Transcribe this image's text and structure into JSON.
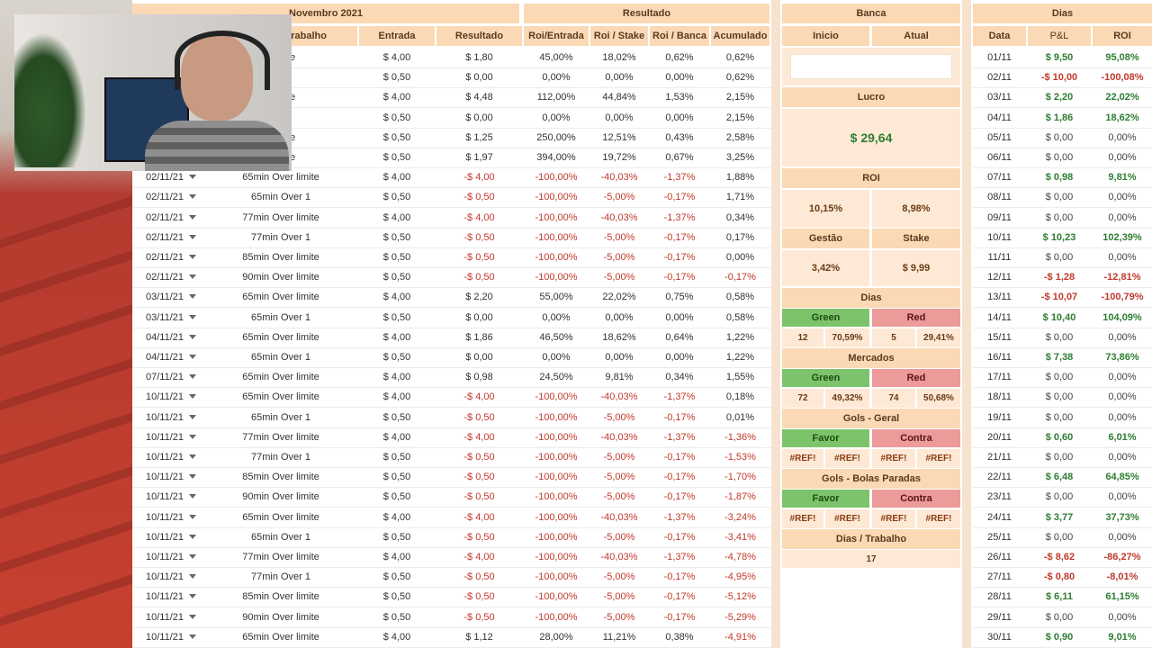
{
  "header": {
    "month": "Novembro 2021",
    "resultado": "Resultado",
    "banca": "Banca",
    "dias": "Dias"
  },
  "columns": {
    "trabalho": "rabalho",
    "entrada": "Entrada",
    "resultado": "Resultado",
    "roi_entrada": "Roi/Entrada",
    "roi_stake": "Roi / Stake",
    "roi_banca": "Roi / Banca",
    "acumulado": "Acumulado",
    "inicio": "Inicio",
    "atual": "Atual",
    "data": "Data",
    "pl": "P&L",
    "roi": "ROI"
  },
  "rows": [
    {
      "date": "",
      "market": "r limite",
      "entrada": "$ 4,00",
      "resultado": "$ 1,80",
      "roi_e": "45,00%",
      "roi_s": "18,02%",
      "roi_b": "0,62%",
      "acum": "0,62%",
      "cls": "zero"
    },
    {
      "date": "",
      "market": "ver 1",
      "entrada": "$ 0,50",
      "resultado": "$ 0,00",
      "roi_e": "0,00%",
      "roi_s": "0,00%",
      "roi_b": "0,00%",
      "acum": "0,62%",
      "cls": "zero"
    },
    {
      "date": "",
      "market": "r limite",
      "entrada": "$ 4,00",
      "resultado": "$ 4,48",
      "roi_e": "112,00%",
      "roi_s": "44,84%",
      "roi_b": "1,53%",
      "acum": "2,15%",
      "cls": "zero"
    },
    {
      "date": "",
      "market": "ver 1",
      "entrada": "$ 0,50",
      "resultado": "$ 0,00",
      "roi_e": "0,00%",
      "roi_s": "0,00%",
      "roi_b": "0,00%",
      "acum": "2,15%",
      "cls": "zero"
    },
    {
      "date": "",
      "market": "r limite",
      "entrada": "$ 0,50",
      "resultado": "$ 1,25",
      "roi_e": "250,00%",
      "roi_s": "12,51%",
      "roi_b": "0,43%",
      "acum": "2,58%",
      "cls": "zero"
    },
    {
      "date": "",
      "market": "r limite",
      "entrada": "$ 0,50",
      "resultado": "$ 1,97",
      "roi_e": "394,00%",
      "roi_s": "19,72%",
      "roi_b": "0,67%",
      "acum": "3,25%",
      "cls": "zero"
    },
    {
      "date": "02/11/21",
      "market": "65min Over limite",
      "entrada": "$ 4,00",
      "resultado": "-$ 4,00",
      "roi_e": "-100,00%",
      "roi_s": "-40,03%",
      "roi_b": "-1,37%",
      "acum": "1,88%",
      "cls": "neg"
    },
    {
      "date": "02/11/21",
      "market": "65min Over 1",
      "entrada": "$ 0,50",
      "resultado": "-$ 0,50",
      "roi_e": "-100,00%",
      "roi_s": "-5,00%",
      "roi_b": "-0,17%",
      "acum": "1,71%",
      "cls": "neg"
    },
    {
      "date": "02/11/21",
      "market": "77min Over limite",
      "entrada": "$ 4,00",
      "resultado": "-$ 4,00",
      "roi_e": "-100,00%",
      "roi_s": "-40,03%",
      "roi_b": "-1,37%",
      "acum": "0,34%",
      "cls": "neg"
    },
    {
      "date": "02/11/21",
      "market": "77min Over 1",
      "entrada": "$ 0,50",
      "resultado": "-$ 0,50",
      "roi_e": "-100,00%",
      "roi_s": "-5,00%",
      "roi_b": "-0,17%",
      "acum": "0,17%",
      "cls": "neg"
    },
    {
      "date": "02/11/21",
      "market": "85min Over limite",
      "entrada": "$ 0,50",
      "resultado": "-$ 0,50",
      "roi_e": "-100,00%",
      "roi_s": "-5,00%",
      "roi_b": "-0,17%",
      "acum": "0,00%",
      "cls": "neg"
    },
    {
      "date": "02/11/21",
      "market": "90min Over limite",
      "entrada": "$ 0,50",
      "resultado": "-$ 0,50",
      "roi_e": "-100,00%",
      "roi_s": "-5,00%",
      "roi_b": "-0,17%",
      "acum": "-0,17%",
      "cls": "neg"
    },
    {
      "date": "03/11/21",
      "market": "65min Over limite",
      "entrada": "$ 4,00",
      "resultado": "$ 2,20",
      "roi_e": "55,00%",
      "roi_s": "22,02%",
      "roi_b": "0,75%",
      "acum": "0,58%",
      "cls": "zero"
    },
    {
      "date": "03/11/21",
      "market": "65min Over 1",
      "entrada": "$ 0,50",
      "resultado": "$ 0,00",
      "roi_e": "0,00%",
      "roi_s": "0,00%",
      "roi_b": "0,00%",
      "acum": "0,58%",
      "cls": "zero"
    },
    {
      "date": "04/11/21",
      "market": "65min Over limite",
      "entrada": "$ 4,00",
      "resultado": "$ 1,86",
      "roi_e": "46,50%",
      "roi_s": "18,62%",
      "roi_b": "0,64%",
      "acum": "1,22%",
      "cls": "zero"
    },
    {
      "date": "04/11/21",
      "market": "65min Over 1",
      "entrada": "$ 0,50",
      "resultado": "$ 0,00",
      "roi_e": "0,00%",
      "roi_s": "0,00%",
      "roi_b": "0,00%",
      "acum": "1,22%",
      "cls": "zero"
    },
    {
      "date": "07/11/21",
      "market": "65min Over limite",
      "entrada": "$ 4,00",
      "resultado": "$ 0,98",
      "roi_e": "24,50%",
      "roi_s": "9,81%",
      "roi_b": "0,34%",
      "acum": "1,55%",
      "cls": "zero"
    },
    {
      "date": "10/11/21",
      "market": "65min Over limite",
      "entrada": "$ 4,00",
      "resultado": "-$ 4,00",
      "roi_e": "-100,00%",
      "roi_s": "-40,03%",
      "roi_b": "-1,37%",
      "acum": "0,18%",
      "cls": "neg"
    },
    {
      "date": "10/11/21",
      "market": "65min Over 1",
      "entrada": "$ 0,50",
      "resultado": "-$ 0,50",
      "roi_e": "-100,00%",
      "roi_s": "-5,00%",
      "roi_b": "-0,17%",
      "acum": "0,01%",
      "cls": "neg"
    },
    {
      "date": "10/11/21",
      "market": "77min Over limite",
      "entrada": "$ 4,00",
      "resultado": "-$ 4,00",
      "roi_e": "-100,00%",
      "roi_s": "-40,03%",
      "roi_b": "-1,37%",
      "acum": "-1,36%",
      "cls": "neg"
    },
    {
      "date": "10/11/21",
      "market": "77min Over 1",
      "entrada": "$ 0,50",
      "resultado": "-$ 0,50",
      "roi_e": "-100,00%",
      "roi_s": "-5,00%",
      "roi_b": "-0,17%",
      "acum": "-1,53%",
      "cls": "neg"
    },
    {
      "date": "10/11/21",
      "market": "85min Over limite",
      "entrada": "$ 0,50",
      "resultado": "-$ 0,50",
      "roi_e": "-100,00%",
      "roi_s": "-5,00%",
      "roi_b": "-0,17%",
      "acum": "-1,70%",
      "cls": "neg"
    },
    {
      "date": "10/11/21",
      "market": "90min Over limite",
      "entrada": "$ 0,50",
      "resultado": "-$ 0,50",
      "roi_e": "-100,00%",
      "roi_s": "-5,00%",
      "roi_b": "-0,17%",
      "acum": "-1,87%",
      "cls": "neg"
    },
    {
      "date": "10/11/21",
      "market": "65min Over limite",
      "entrada": "$ 4,00",
      "resultado": "-$ 4,00",
      "roi_e": "-100,00%",
      "roi_s": "-40,03%",
      "roi_b": "-1,37%",
      "acum": "-3,24%",
      "cls": "neg"
    },
    {
      "date": "10/11/21",
      "market": "65min Over 1",
      "entrada": "$ 0,50",
      "resultado": "-$ 0,50",
      "roi_e": "-100,00%",
      "roi_s": "-5,00%",
      "roi_b": "-0,17%",
      "acum": "-3,41%",
      "cls": "neg"
    },
    {
      "date": "10/11/21",
      "market": "77min Over limite",
      "entrada": "$ 4,00",
      "resultado": "-$ 4,00",
      "roi_e": "-100,00%",
      "roi_s": "-40,03%",
      "roi_b": "-1,37%",
      "acum": "-4,78%",
      "cls": "neg"
    },
    {
      "date": "10/11/21",
      "market": "77min Over 1",
      "entrada": "$ 0,50",
      "resultado": "-$ 0,50",
      "roi_e": "-100,00%",
      "roi_s": "-5,00%",
      "roi_b": "-0,17%",
      "acum": "-4,95%",
      "cls": "neg"
    },
    {
      "date": "10/11/21",
      "market": "85min Over limite",
      "entrada": "$ 0,50",
      "resultado": "-$ 0,50",
      "roi_e": "-100,00%",
      "roi_s": "-5,00%",
      "roi_b": "-0,17%",
      "acum": "-5,12%",
      "cls": "neg"
    },
    {
      "date": "10/11/21",
      "market": "90min Over limite",
      "entrada": "$ 0,50",
      "resultado": "-$ 0,50",
      "roi_e": "-100,00%",
      "roi_s": "-5,00%",
      "roi_b": "-0,17%",
      "acum": "-5,29%",
      "cls": "neg"
    },
    {
      "date": "10/11/21",
      "market": "65min Over limite",
      "entrada": "$ 4,00",
      "resultado": "$ 1,12",
      "roi_e": "28,00%",
      "roi_s": "11,21%",
      "roi_b": "0,38%",
      "acum": "-4,91%",
      "cls": "zero"
    }
  ],
  "banca": {
    "lucro_label": "Lucro",
    "lucro_value": "$ 29,64",
    "roi_label": "ROI",
    "roi_a": "10,15%",
    "roi_b": "8,98%",
    "gestao_label": "Gestão",
    "stake_label": "Stake",
    "gestao_value": "3,42%",
    "stake_value": "$ 9,99",
    "dias_label": "Dias",
    "green_label": "Green",
    "red_label": "Red",
    "dias_green": "12",
    "dias_green_pct": "70,59%",
    "dias_red": "5",
    "dias_red_pct": "29,41%",
    "mercados_label": "Mercados",
    "merc_green": "72",
    "merc_green_pct": "49,32%",
    "merc_red": "74",
    "merc_red_pct": "50,68%",
    "gols_geral_label": "Gols - Geral",
    "favor_label": "Favor",
    "contra_label": "Contra",
    "ref": "#REF!",
    "gols_bp_label": "Gols - Bolas Paradas",
    "dias_trabalho_label": "Dias / Trabalho",
    "dias_trabalho_value": "17"
  },
  "dias": [
    {
      "d": "01/11",
      "pl": "$ 9,50",
      "roi": "95,08%",
      "cls": "pos"
    },
    {
      "d": "02/11",
      "pl": "-$ 10,00",
      "roi": "-100,08%",
      "cls": "neg"
    },
    {
      "d": "03/11",
      "pl": "$ 2,20",
      "roi": "22,02%",
      "cls": "pos"
    },
    {
      "d": "04/11",
      "pl": "$ 1,86",
      "roi": "18,62%",
      "cls": "pos"
    },
    {
      "d": "05/11",
      "pl": "$ 0,00",
      "roi": "0,00%",
      "cls": "zero"
    },
    {
      "d": "06/11",
      "pl": "$ 0,00",
      "roi": "0,00%",
      "cls": "zero"
    },
    {
      "d": "07/11",
      "pl": "$ 0,98",
      "roi": "9,81%",
      "cls": "pos"
    },
    {
      "d": "08/11",
      "pl": "$ 0,00",
      "roi": "0,00%",
      "cls": "zero"
    },
    {
      "d": "09/11",
      "pl": "$ 0,00",
      "roi": "0,00%",
      "cls": "zero"
    },
    {
      "d": "10/11",
      "pl": "$ 10,23",
      "roi": "102,39%",
      "cls": "pos"
    },
    {
      "d": "11/11",
      "pl": "$ 0,00",
      "roi": "0,00%",
      "cls": "zero"
    },
    {
      "d": "12/11",
      "pl": "-$ 1,28",
      "roi": "-12,81%",
      "cls": "neg"
    },
    {
      "d": "13/11",
      "pl": "-$ 10,07",
      "roi": "-100,79%",
      "cls": "neg"
    },
    {
      "d": "14/11",
      "pl": "$ 10,40",
      "roi": "104,09%",
      "cls": "pos"
    },
    {
      "d": "15/11",
      "pl": "$ 0,00",
      "roi": "0,00%",
      "cls": "zero"
    },
    {
      "d": "16/11",
      "pl": "$ 7,38",
      "roi": "73,86%",
      "cls": "pos"
    },
    {
      "d": "17/11",
      "pl": "$ 0,00",
      "roi": "0,00%",
      "cls": "zero"
    },
    {
      "d": "18/11",
      "pl": "$ 0,00",
      "roi": "0,00%",
      "cls": "zero"
    },
    {
      "d": "19/11",
      "pl": "$ 0,00",
      "roi": "0,00%",
      "cls": "zero"
    },
    {
      "d": "20/11",
      "pl": "$ 0,60",
      "roi": "6,01%",
      "cls": "pos"
    },
    {
      "d": "21/11",
      "pl": "$ 0,00",
      "roi": "0,00%",
      "cls": "zero"
    },
    {
      "d": "22/11",
      "pl": "$ 6,48",
      "roi": "64,85%",
      "cls": "pos"
    },
    {
      "d": "23/11",
      "pl": "$ 0,00",
      "roi": "0,00%",
      "cls": "zero"
    },
    {
      "d": "24/11",
      "pl": "$ 3,77",
      "roi": "37,73%",
      "cls": "pos"
    },
    {
      "d": "25/11",
      "pl": "$ 0,00",
      "roi": "0,00%",
      "cls": "zero"
    },
    {
      "d": "26/11",
      "pl": "-$ 8,62",
      "roi": "-86,27%",
      "cls": "neg"
    },
    {
      "d": "27/11",
      "pl": "-$ 0,80",
      "roi": "-8,01%",
      "cls": "neg"
    },
    {
      "d": "28/11",
      "pl": "$ 6,11",
      "roi": "61,15%",
      "cls": "pos"
    },
    {
      "d": "29/11",
      "pl": "$ 0,00",
      "roi": "0,00%",
      "cls": "zero"
    },
    {
      "d": "30/11",
      "pl": "$ 0,90",
      "roi": "9,01%",
      "cls": "pos"
    }
  ],
  "colors": {
    "header": "#fbd9b5",
    "green": "#7dc36b",
    "red": "#ec9a9a",
    "neg_text": "#c0392b",
    "pos_text": "#2e7d32"
  }
}
